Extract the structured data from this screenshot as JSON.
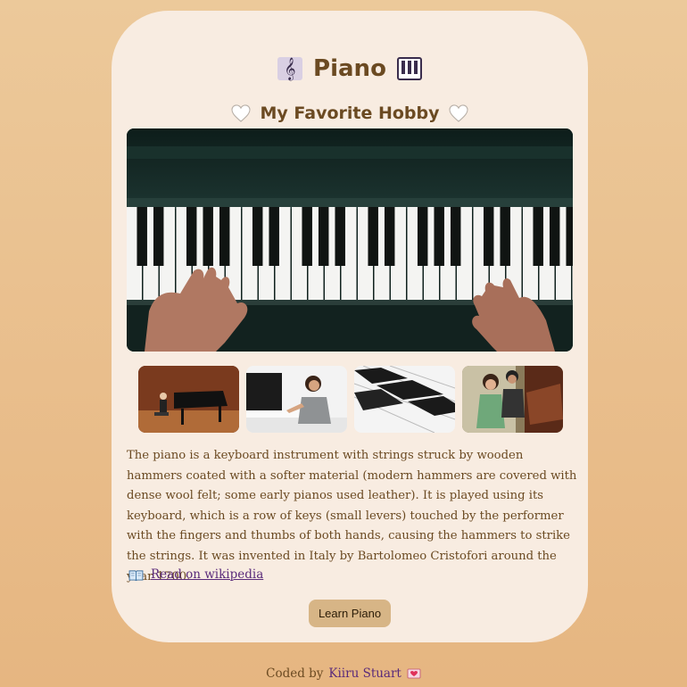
{
  "header": {
    "title": "Piano",
    "left_icon": "musical-score-icon",
    "right_icon": "piano-keys-icon"
  },
  "subtitle": {
    "text": "My Favorite Hobby",
    "icon": "white-heart-icon"
  },
  "images": {
    "hero": "piano-keys-hands-photo",
    "thumbnails": [
      "grand-piano-stage-photo",
      "girl-playing-piano-photo",
      "piano-keys-closeup-photo",
      "people-at-piano-photo"
    ]
  },
  "description": "The piano is a keyboard instrument with strings struck by wooden hammers coated with a softer material (modern hammers are covered with dense wool felt; some early pianos used leather). It is played using its keyboard, which is a row of keys (small levers) touched by the performer with the fingers and thumbs of both hands, causing the hammers to strike the strings. It was invented in Italy by Bartolomeo Cristofori around the year 1700.",
  "wiki_link": {
    "label": "Read on wikipedia",
    "icon": "open-book-icon"
  },
  "button": {
    "label": "Learn Piano"
  },
  "footer": {
    "prefix": "Coded by",
    "author": "Kiiru Stuart",
    "icon": "heart-letter-icon"
  },
  "colors": {
    "background": "#e9be8c",
    "card": "#f8ece1",
    "text": "#6b4a22",
    "link": "#5a2a7a",
    "button": "#d7b586"
  }
}
